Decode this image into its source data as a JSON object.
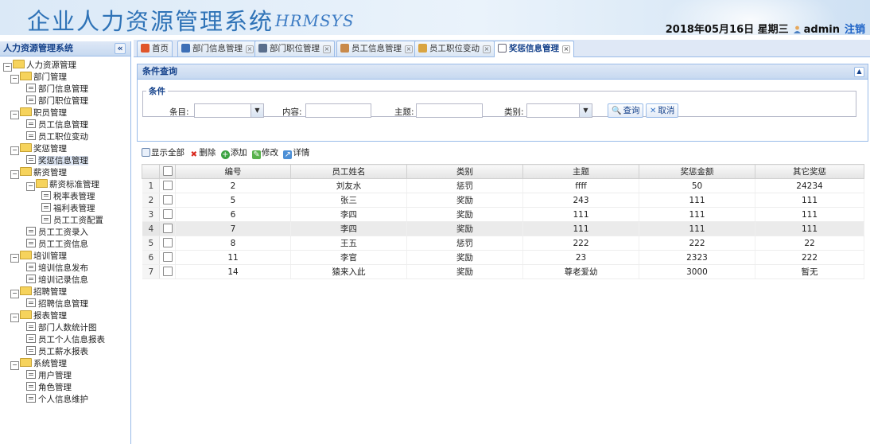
{
  "header": {
    "title": "企业人力资源管理系统",
    "subtitle": "HRMSYS",
    "date": "2018年05月16日 星期三",
    "username": "admin",
    "logout": "注销"
  },
  "sidebar": {
    "title": "人力资源管理系统",
    "collapse": "«",
    "tree": [
      {
        "label": "人力资源管理",
        "type": "folder",
        "level": 0
      },
      {
        "label": "部门管理",
        "type": "folder",
        "level": 1
      },
      {
        "label": "部门信息管理",
        "type": "file",
        "level": 2
      },
      {
        "label": "部门职位管理",
        "type": "file",
        "level": 2
      },
      {
        "label": "职员管理",
        "type": "folder",
        "level": 1
      },
      {
        "label": "员工信息管理",
        "type": "file",
        "level": 2
      },
      {
        "label": "员工职位变动",
        "type": "file",
        "level": 2
      },
      {
        "label": "奖惩管理",
        "type": "folder",
        "level": 1
      },
      {
        "label": "奖惩信息管理",
        "type": "file",
        "level": 2
      },
      {
        "label": "薪资管理",
        "type": "folder",
        "level": 1
      },
      {
        "label": "薪资标准管理",
        "type": "folder",
        "level": 2
      },
      {
        "label": "税率表管理",
        "type": "file",
        "level": 3
      },
      {
        "label": "福利表管理",
        "type": "file",
        "level": 3
      },
      {
        "label": "员工工资配置",
        "type": "file",
        "level": 3
      },
      {
        "label": "员工工资录入",
        "type": "file",
        "level": 2
      },
      {
        "label": "员工工资信息",
        "type": "file",
        "level": 2
      },
      {
        "label": "培训管理",
        "type": "folder",
        "level": 1
      },
      {
        "label": "培训信息发布",
        "type": "file",
        "level": 2
      },
      {
        "label": "培训记录信息",
        "type": "file",
        "level": 2
      },
      {
        "label": "招聘管理",
        "type": "folder",
        "level": 1
      },
      {
        "label": "招聘信息管理",
        "type": "file",
        "level": 2
      },
      {
        "label": "报表管理",
        "type": "folder",
        "level": 1
      },
      {
        "label": "部门人数统计图",
        "type": "file",
        "level": 2
      },
      {
        "label": "员工个人信息报表",
        "type": "file",
        "level": 2
      },
      {
        "label": "员工薪水报表",
        "type": "file",
        "level": 2
      },
      {
        "label": "系统管理",
        "type": "folder",
        "level": 1
      },
      {
        "label": "用户管理",
        "type": "file",
        "level": 2
      },
      {
        "label": "角色管理",
        "type": "file",
        "level": 2
      },
      {
        "label": "个人信息维护",
        "type": "file",
        "level": 2
      }
    ]
  },
  "tabs": [
    {
      "label": "首页",
      "closable": false
    },
    {
      "label": "部门信息管理",
      "closable": true
    },
    {
      "label": "部门职位管理",
      "closable": true
    },
    {
      "label": "员工信息管理",
      "closable": true
    },
    {
      "label": "员工职位变动",
      "closable": true
    },
    {
      "label": "奖惩信息管理",
      "closable": true,
      "active": true
    }
  ],
  "query": {
    "panel_title": "条件查询",
    "legend": "条件",
    "item_label": "条目:",
    "item_value": "",
    "content_label": "内容:",
    "content_value": "",
    "subject_label": "主题:",
    "subject_value": "",
    "type_label": "类别:",
    "type_value": "",
    "search_button": "查询",
    "cancel_button": "取消"
  },
  "toolbar": {
    "show_all": "显示全部",
    "delete": "删除",
    "add": "添加",
    "edit": "修改",
    "detail": "详情"
  },
  "table": {
    "columns": [
      "编号",
      "员工姓名",
      "类别",
      "主题",
      "奖惩金额",
      "其它奖惩"
    ],
    "rows": [
      [
        "2",
        "刘友水",
        "惩罚",
        "ffff",
        "50",
        "24234"
      ],
      [
        "5",
        "张三",
        "奖励",
        "243",
        "111",
        "111"
      ],
      [
        "6",
        "李四",
        "奖励",
        "111",
        "111",
        "111"
      ],
      [
        "7",
        "李四",
        "奖励",
        "111",
        "111",
        "111"
      ],
      [
        "8",
        "王五",
        "惩罚",
        "222",
        "222",
        "22"
      ],
      [
        "11",
        "李官",
        "奖励",
        "23",
        "2323",
        "222"
      ],
      [
        "14",
        "猿来入此",
        "奖励",
        "尊老爱幼",
        "3000",
        "暂无"
      ]
    ],
    "row_numbers": [
      "1",
      "2",
      "3",
      "4",
      "5",
      "6",
      "7"
    ]
  },
  "colors": {
    "accent": "#15428b",
    "title": "#2f73b7",
    "border": "#99bbe8"
  }
}
